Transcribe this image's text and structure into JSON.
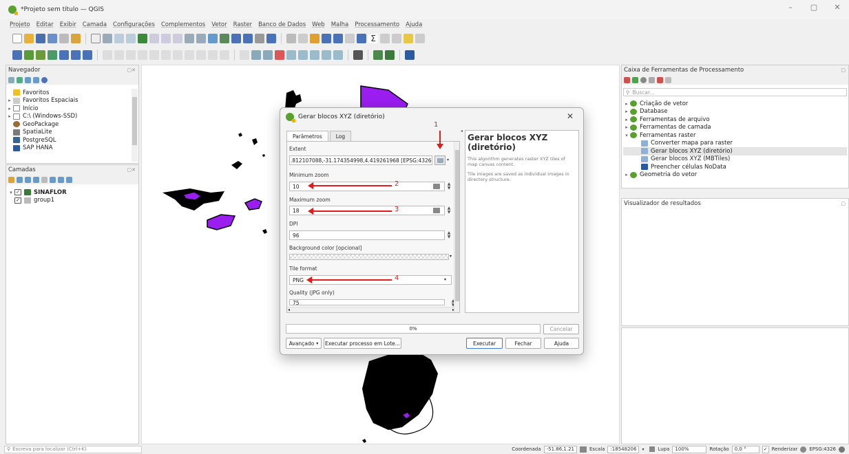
{
  "window": {
    "title": "*Projeto sem título — QGIS",
    "controls": [
      "–",
      "▢",
      "✕"
    ]
  },
  "menu": [
    "Projeto",
    "Editar",
    "Exibir",
    "Camada",
    "Configurações",
    "Complementos",
    "Vetor",
    "Raster",
    "Banco de Dados",
    "Web",
    "Malha",
    "Processamento",
    "Ajuda"
  ],
  "browser": {
    "title": "Navegador",
    "items": [
      {
        "label": "Favoritos",
        "icon": "star-icon",
        "arrow": ""
      },
      {
        "label": "Favoritos Espaciais",
        "icon": "spatial-bookmark-icon",
        "arrow": "▸"
      },
      {
        "label": "Início",
        "icon": "home-folder-icon",
        "arrow": "▸"
      },
      {
        "label": "C:\\ (Windows-SSD)",
        "icon": "drive-icon",
        "arrow": "▸"
      },
      {
        "label": "GeoPackage",
        "icon": "geopackage-icon",
        "arrow": ""
      },
      {
        "label": "SpatiaLite",
        "icon": "spatialite-icon",
        "arrow": ""
      },
      {
        "label": "PostgreSQL",
        "icon": "postgresql-icon",
        "arrow": ""
      },
      {
        "label": "SAP HANA",
        "icon": "sap-hana-icon",
        "arrow": ""
      }
    ]
  },
  "layers": {
    "title": "Camadas",
    "items": [
      {
        "label": "SINAFLOR",
        "bold": true
      },
      {
        "label": "group1",
        "bold": false
      }
    ]
  },
  "toolbox": {
    "title": "Caixa de Ferramentas de Processamento",
    "search_placeholder": "Buscar...",
    "items": [
      {
        "label": "Criação de vetor",
        "level": 0,
        "arrow": "▸"
      },
      {
        "label": "Database",
        "level": 0,
        "arrow": "▸"
      },
      {
        "label": "Ferramentas de arquivo",
        "level": 0,
        "arrow": "▸"
      },
      {
        "label": "Ferramentas de camada",
        "level": 0,
        "arrow": "▸"
      },
      {
        "label": "Ferramentas raster",
        "level": 0,
        "arrow": "▾"
      },
      {
        "label": "Converter mapa para raster",
        "level": 1,
        "arrow": ""
      },
      {
        "label": "Gerar blocos XYZ (diretório)",
        "level": 1,
        "arrow": "",
        "selected": true
      },
      {
        "label": "Gerar blocos XYZ (MBTiles)",
        "level": 1,
        "arrow": ""
      },
      {
        "label": "Preencher células NoData",
        "level": 1,
        "arrow": ""
      },
      {
        "label": "Geometria do vetor",
        "level": 0,
        "arrow": "▸"
      }
    ]
  },
  "results": {
    "title": "Visualizador de resultados"
  },
  "dialog": {
    "title": "Gerar blocos XYZ (diretório)",
    "tab_params": "Parâmetros",
    "tab_log": "Log",
    "extent_label": "Extent",
    "extent_value": ".812107088,-31.174354998,4.419261968 [EPSG:4326]",
    "minzoom_label": "Minimum zoom",
    "minzoom_value": "10",
    "maxzoom_label": "Maximum zoom",
    "maxzoom_value": "18",
    "dpi_label": "DPI",
    "dpi_value": "96",
    "bg_label": "Background color [opcional]",
    "tile_format_label": "Tile format",
    "tile_format_value": "PNG",
    "quality_label": "Quality (JPG only)",
    "quality_value": "75",
    "help_title": "Gerar blocos XYZ (diretório)",
    "help_p1": "This algorithm generates raster XYZ tiles of map canvas content.",
    "help_p2": "Tile images are saved as individual images in directory structure.",
    "progress": "0%",
    "cancel": "Cancelar",
    "advanced": "Avançado",
    "batch": "Executar processo em Lote...",
    "run": "Executar",
    "close": "Fechar",
    "help": "Ajuda"
  },
  "annotations": [
    "1",
    "2",
    "3",
    "4"
  ],
  "status": {
    "locator_placeholder": "Escreva para localizar (Ctrl+K)",
    "coord_label": "Coordenada",
    "coord_value": "-51.86,1.21",
    "scale_label": "Escala",
    "scale_value": ":18548206",
    "magnifier_label": "Lupa",
    "magnifier_value": "100%",
    "rotation_label": "Rotação",
    "rotation_value": "0,0 °",
    "render_label": "Renderizar",
    "crs": "EPSG:4326"
  },
  "colors": {
    "accent": "#8a1ee0",
    "arrow": "#e21b1b",
    "qgis_green": "#5aa02c"
  }
}
